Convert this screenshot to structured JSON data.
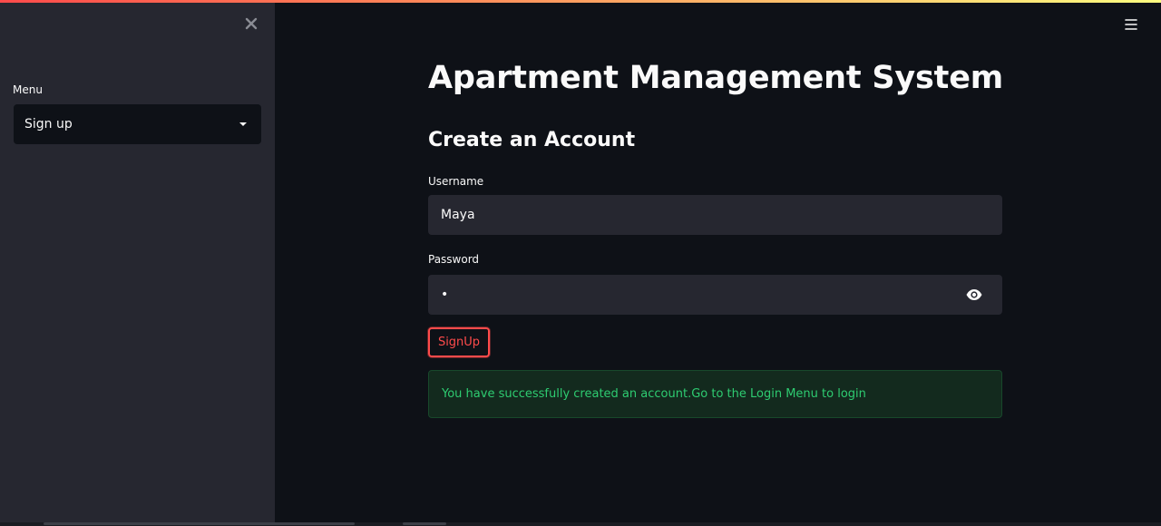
{
  "sidebar": {
    "menu_label": "Menu",
    "select_value": "Sign up"
  },
  "main": {
    "title": "Apartment Management System",
    "subtitle": "Create an Account",
    "username_label": "Username",
    "username_value": "Maya",
    "password_label": "Password",
    "password_masked": "•",
    "signup_button": "SignUp",
    "success_message": "You have successfully created an account.Go to the Login Menu to login"
  },
  "colors": {
    "background": "#0e1117",
    "sidebar": "#262730",
    "accent": "#ff4b4b",
    "success_text": "#2ecc71",
    "success_bg": "#132a1e"
  },
  "icons": {
    "close": "close-icon",
    "menu": "hamburger-icon",
    "dropdown": "chevron-down-icon",
    "reveal_password": "eye-icon"
  }
}
